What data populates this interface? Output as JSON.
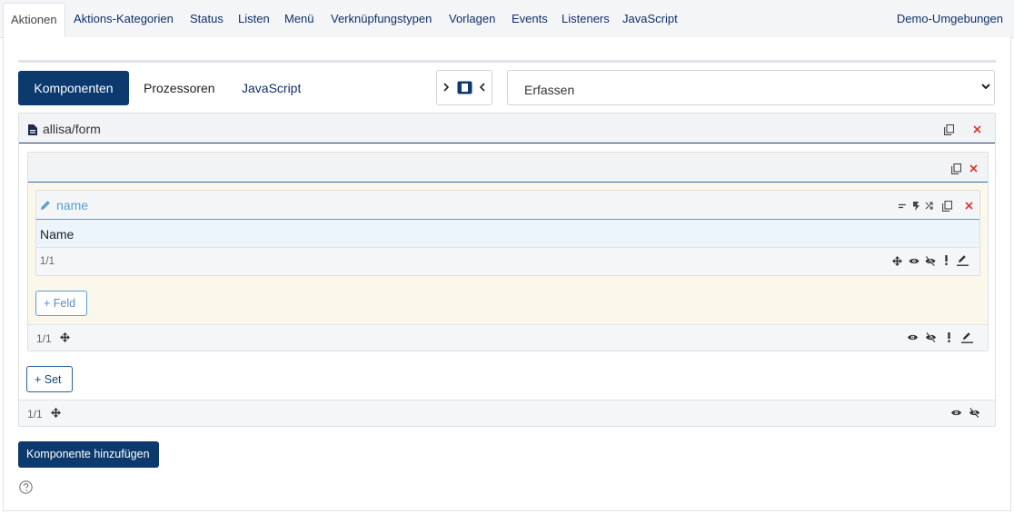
{
  "top_tabs": [
    {
      "label": "Aktionen",
      "active": true
    },
    {
      "label": "Aktions-Kategorien"
    },
    {
      "label": "Status"
    },
    {
      "label": "Listen"
    },
    {
      "label": "Menü"
    },
    {
      "label": "Verknüpfungstypen"
    },
    {
      "label": "Vorlagen"
    },
    {
      "label": "Events"
    },
    {
      "label": "Listeners"
    },
    {
      "label": "JavaScript"
    }
  ],
  "demo_link": "Demo-Umgebungen",
  "sub_tabs": [
    {
      "label": "Komponenten",
      "active": true
    },
    {
      "label": "Prozessoren"
    },
    {
      "label": "JavaScript"
    }
  ],
  "select": {
    "value": "Erfassen"
  },
  "component": {
    "title": "allisa/form",
    "counter": "1/1",
    "set": {
      "counter": "1/1",
      "field": {
        "title": "name",
        "label": "Name",
        "counter": "1/1"
      },
      "add_field_label": "+ Feld"
    },
    "add_set_label": "+ Set"
  },
  "add_component_label": "Komponente hinzufügen",
  "colors": {
    "primary": "#0c3a6e",
    "danger": "#d9372c",
    "link": "#5a9fd4"
  }
}
